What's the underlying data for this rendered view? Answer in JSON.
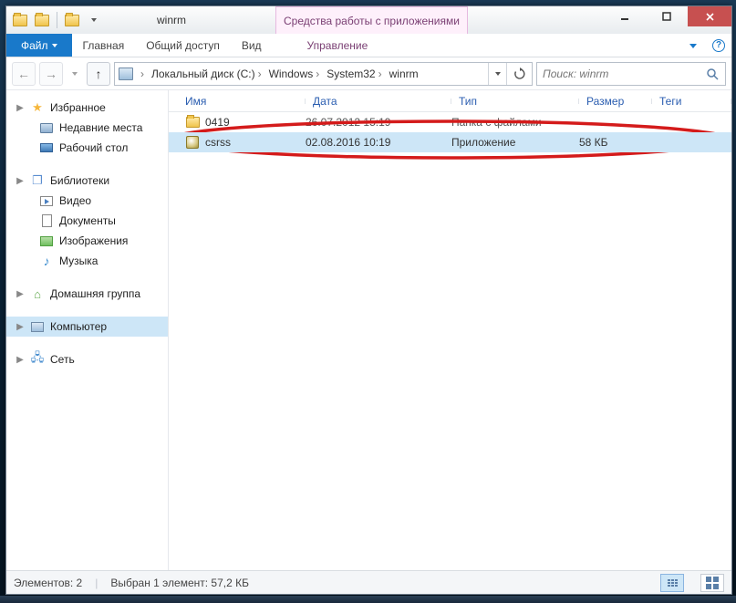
{
  "window": {
    "title": "winrm",
    "context_tab": "Средства работы с приложениями"
  },
  "ribbon": {
    "file": "Файл",
    "tabs": [
      "Главная",
      "Общий доступ",
      "Вид"
    ],
    "ctx_tab": "Управление"
  },
  "breadcrumbs": [
    "Локальный диск (C:)",
    "Windows",
    "System32",
    "winrm"
  ],
  "search": {
    "placeholder": "Поиск: winrm"
  },
  "sidebar": {
    "favorites": {
      "label": "Избранное",
      "items": [
        "Недавние места",
        "Рабочий стол"
      ]
    },
    "libraries": {
      "label": "Библиотеки",
      "items": [
        "Видео",
        "Документы",
        "Изображения",
        "Музыка"
      ]
    },
    "homegroup": "Домашняя группа",
    "computer": "Компьютер",
    "network": "Сеть"
  },
  "columns": {
    "name": "Имя",
    "date": "Дата",
    "type": "Тип",
    "size": "Размер",
    "tags": "Теги"
  },
  "rows": [
    {
      "name": "0419",
      "date": "26.07.2012 15:19",
      "type": "Папка с файлами",
      "size": ""
    },
    {
      "name": "csrss",
      "date": "02.08.2016 10:19",
      "type": "Приложение",
      "size": "58 КБ"
    }
  ],
  "status": {
    "count": "Элементов: 2",
    "selection": "Выбран 1 элемент: 57,2 КБ"
  },
  "annotation_color": "#d41b1b"
}
